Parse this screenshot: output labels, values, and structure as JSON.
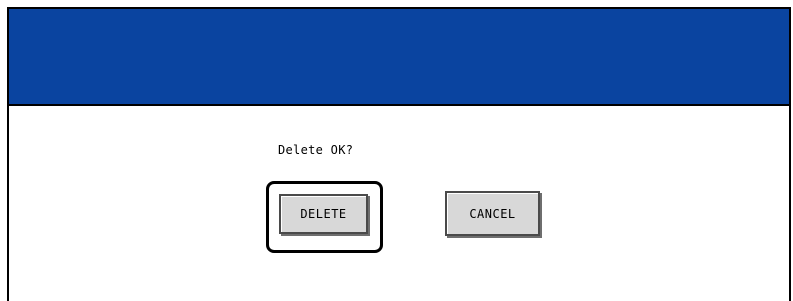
{
  "dialog": {
    "title": "",
    "prompt": "Delete OK?",
    "delete_label": "DELETE",
    "cancel_label": "CANCEL",
    "focused_button": "DELETE",
    "colors": {
      "title_bar": "#0a44a0",
      "button_face": "#d8d8d8",
      "background": "#ffffff"
    }
  }
}
